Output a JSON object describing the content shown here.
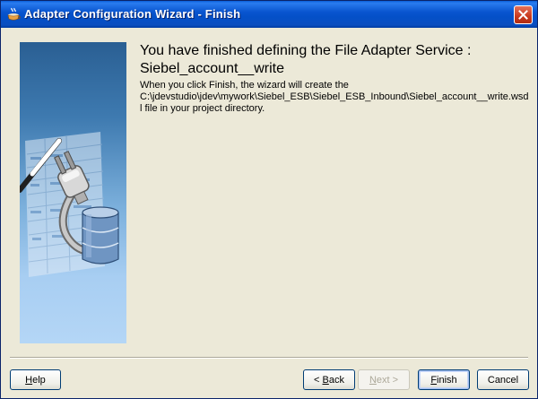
{
  "window": {
    "title": "Adapter Configuration Wizard - Finish"
  },
  "main": {
    "heading_line1": "You have finished defining the File Adapter Service :",
    "heading_line2": "Siebel_account__write",
    "desc_line1": "When you click Finish, the wizard will create the",
    "desc_line2": "C:\\jdevstudio\\jdev\\mywork\\Siebel_ESB\\Siebel_ESB_Inbound\\Siebel_account__write.wsd",
    "desc_line3": "l file in your project directory."
  },
  "buttons": {
    "help": {
      "pre": "",
      "mnemonic": "H",
      "post": "elp"
    },
    "back": {
      "pre": "< ",
      "mnemonic": "B",
      "post": "ack"
    },
    "next": {
      "pre": "",
      "mnemonic": "N",
      "post": "ext >"
    },
    "finish": {
      "pre": "",
      "mnemonic": "F",
      "post": "inish"
    },
    "cancel": "Cancel"
  },
  "icons": {
    "title": "coffee-cup-icon",
    "close": "close-icon",
    "art": "plug-database-illustration"
  },
  "colors": {
    "titlebar": "#0a56d0",
    "window_bg": "#ece9d8",
    "close_button": "#c83a1e",
    "art_top": "#2a5f93",
    "art_bottom": "#b4d6f6"
  }
}
